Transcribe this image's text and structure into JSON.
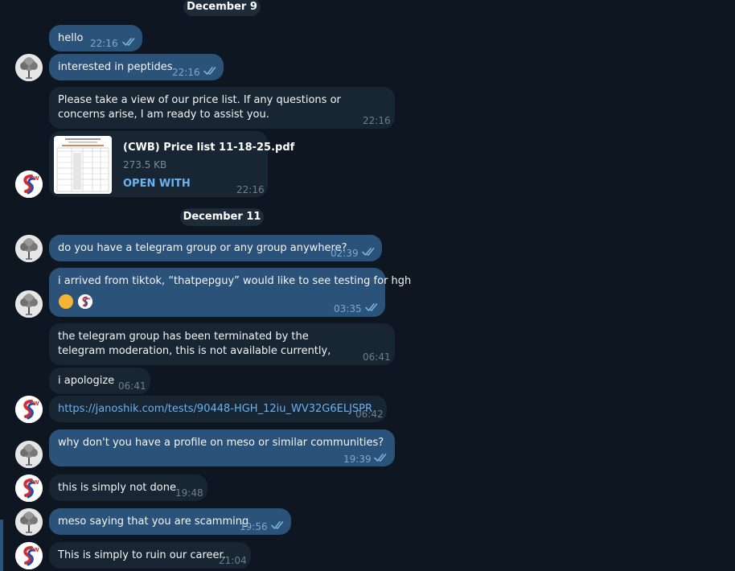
{
  "dates": {
    "d1": "December 9",
    "d2": "December 11"
  },
  "messages": {
    "m1": {
      "text": "hello",
      "time": "22:16"
    },
    "m2": {
      "text": "interested in peptides",
      "time": "22:16"
    },
    "m3": {
      "text": "Please take a view of our price list. If any questions or concerns arise, I am ready to assist you.",
      "time": "22:16"
    },
    "m4": {
      "file_name": "(CWB) Price list 11-18-25.pdf",
      "file_size": "273.5 KB",
      "open_label": "OPEN WITH",
      "time": "22:16"
    },
    "m5": {
      "text": "do you have a telegram group or any group anywhere?",
      "time": "02:39"
    },
    "m6": {
      "text": "i arrived from tiktok, “thatpepguy” would like to see testing for hgh",
      "time": "03:35"
    },
    "m7": {
      "text": "the telegram group has been terminated by the telegram moderation, this is not available currently,",
      "time": "06:41"
    },
    "m8": {
      "text": "i apologize",
      "time": "06:41"
    },
    "m9": {
      "text": "https://janoshik.com/tests/90448-HGH_12iu_WV32G6ELJSPR",
      "time": "06:42"
    },
    "m10": {
      "text": "why don't you have a profile on meso or similar communities?",
      "time": "19:39"
    },
    "m11": {
      "text": "this is simply not done",
      "time": "19:48"
    },
    "m12": {
      "text": "meso saying that you are scamming",
      "time": "19:56"
    },
    "m13": {
      "text": "This is simply to ruin our career.",
      "time": "21:04"
    }
  },
  "colors": {
    "background": "#0e1621",
    "outgoing": "#2b5278",
    "incoming": "#182533",
    "link": "#6ab2f2",
    "logo_red": "#d32f2f",
    "logo_blue": "#2a4aa8"
  },
  "icons": {
    "read": "double-check-icon",
    "user_avatar": "tree-avatar",
    "seller_avatar": "sw-logo-avatar"
  }
}
